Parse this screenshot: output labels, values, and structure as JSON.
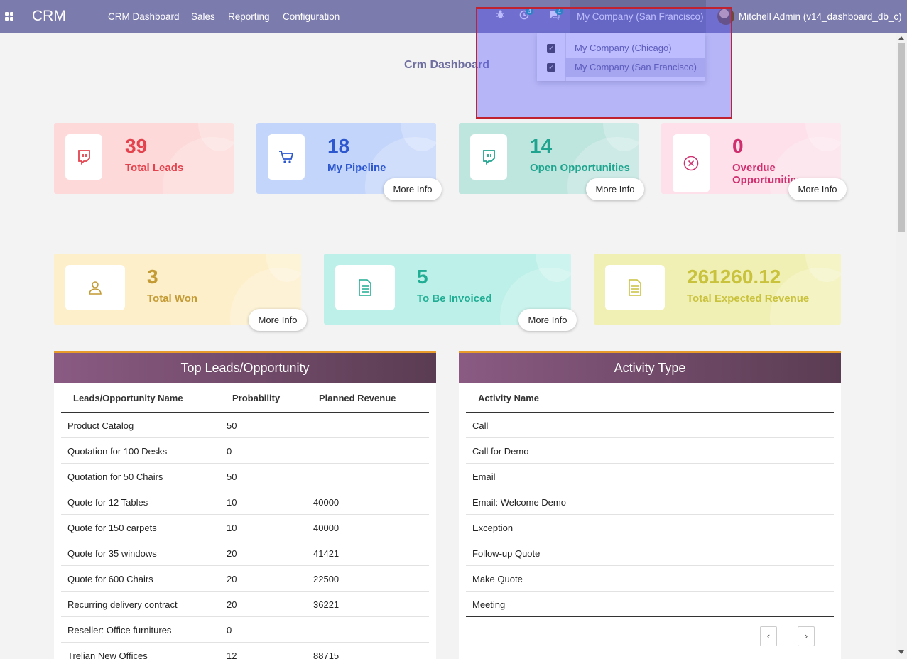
{
  "navbar": {
    "brand": "CRM",
    "menus": [
      "CRM Dashboard",
      "Sales",
      "Reporting",
      "Configuration"
    ],
    "activity_badge": "4",
    "message_badge": "4",
    "current_company": "My Company (San Francisco)",
    "user": "Mitchell Admin (v14_dashboard_db_c)"
  },
  "company_dropdown": {
    "items": [
      {
        "label": "My Company (Chicago)",
        "checked": true
      },
      {
        "label": "My Company (San Francisco)",
        "checked": true
      }
    ]
  },
  "page_title": "Crm Dashboard",
  "kpis": [
    {
      "value": "39",
      "label": "Total Leads",
      "icon": "twitch-icon",
      "color": "#e4434e",
      "bg": "#fdd9d9"
    },
    {
      "value": "18",
      "label": "My Pipeline",
      "icon": "cart-icon",
      "color": "#2d57cf",
      "bg": "#c3d5fb",
      "more": "More Info"
    },
    {
      "value": "14",
      "label": "Open Opportunities",
      "icon": "twitch-icon",
      "color": "#1fa58f",
      "bg": "#bfe5df",
      "more": "More Info"
    },
    {
      "value": "0",
      "label": "Overdue Opportunities",
      "icon": "close-circle-icon",
      "color": "#cf2f6e",
      "bg": "#fde0ea",
      "more": "More Info"
    },
    {
      "value": "3",
      "label": "Total Won",
      "icon": "user-icon",
      "color": "#c39a33",
      "bg": "#fdefc9",
      "more": "More Info"
    },
    {
      "value": "5",
      "label": "To Be Invoiced",
      "icon": "document-icon",
      "color": "#1fad94",
      "bg": "#bdf0e8",
      "more": "More Info"
    },
    {
      "value": "261260.12",
      "label": "Total Expected Revenue",
      "icon": "document-icon",
      "color": "#c9c23d",
      "bg": "#f1f0b4"
    }
  ],
  "leads_table": {
    "title": "Top Leads/Opportunity",
    "headers": [
      "Leads/Opportunity Name",
      "Probability",
      "Planned Revenue"
    ],
    "rows": [
      [
        "Product Catalog",
        "50",
        ""
      ],
      [
        "Quotation for 100 Desks",
        "0",
        ""
      ],
      [
        "Quotation for 50 Chairs",
        "50",
        ""
      ],
      [
        "Quote for 12 Tables",
        "10",
        "40000"
      ],
      [
        "Quote for 150 carpets",
        "10",
        "40000"
      ],
      [
        "Quote for 35 windows",
        "20",
        "41421"
      ],
      [
        "Quote for 600 Chairs",
        "20",
        "22500"
      ],
      [
        "Recurring delivery contract",
        "20",
        "36221"
      ],
      [
        "Reseller: Office furnitures",
        "0",
        ""
      ],
      [
        "Trelian New Offices",
        "12",
        "88715"
      ]
    ]
  },
  "activity_table": {
    "title": "Activity Type",
    "header": "Activity Name",
    "rows": [
      "Call",
      "Call for Demo",
      "Email",
      "Email: Welcome Demo",
      "Exception",
      "Follow-up Quote",
      "Make Quote",
      "Meeting"
    ],
    "prev": "‹",
    "next": "›"
  }
}
